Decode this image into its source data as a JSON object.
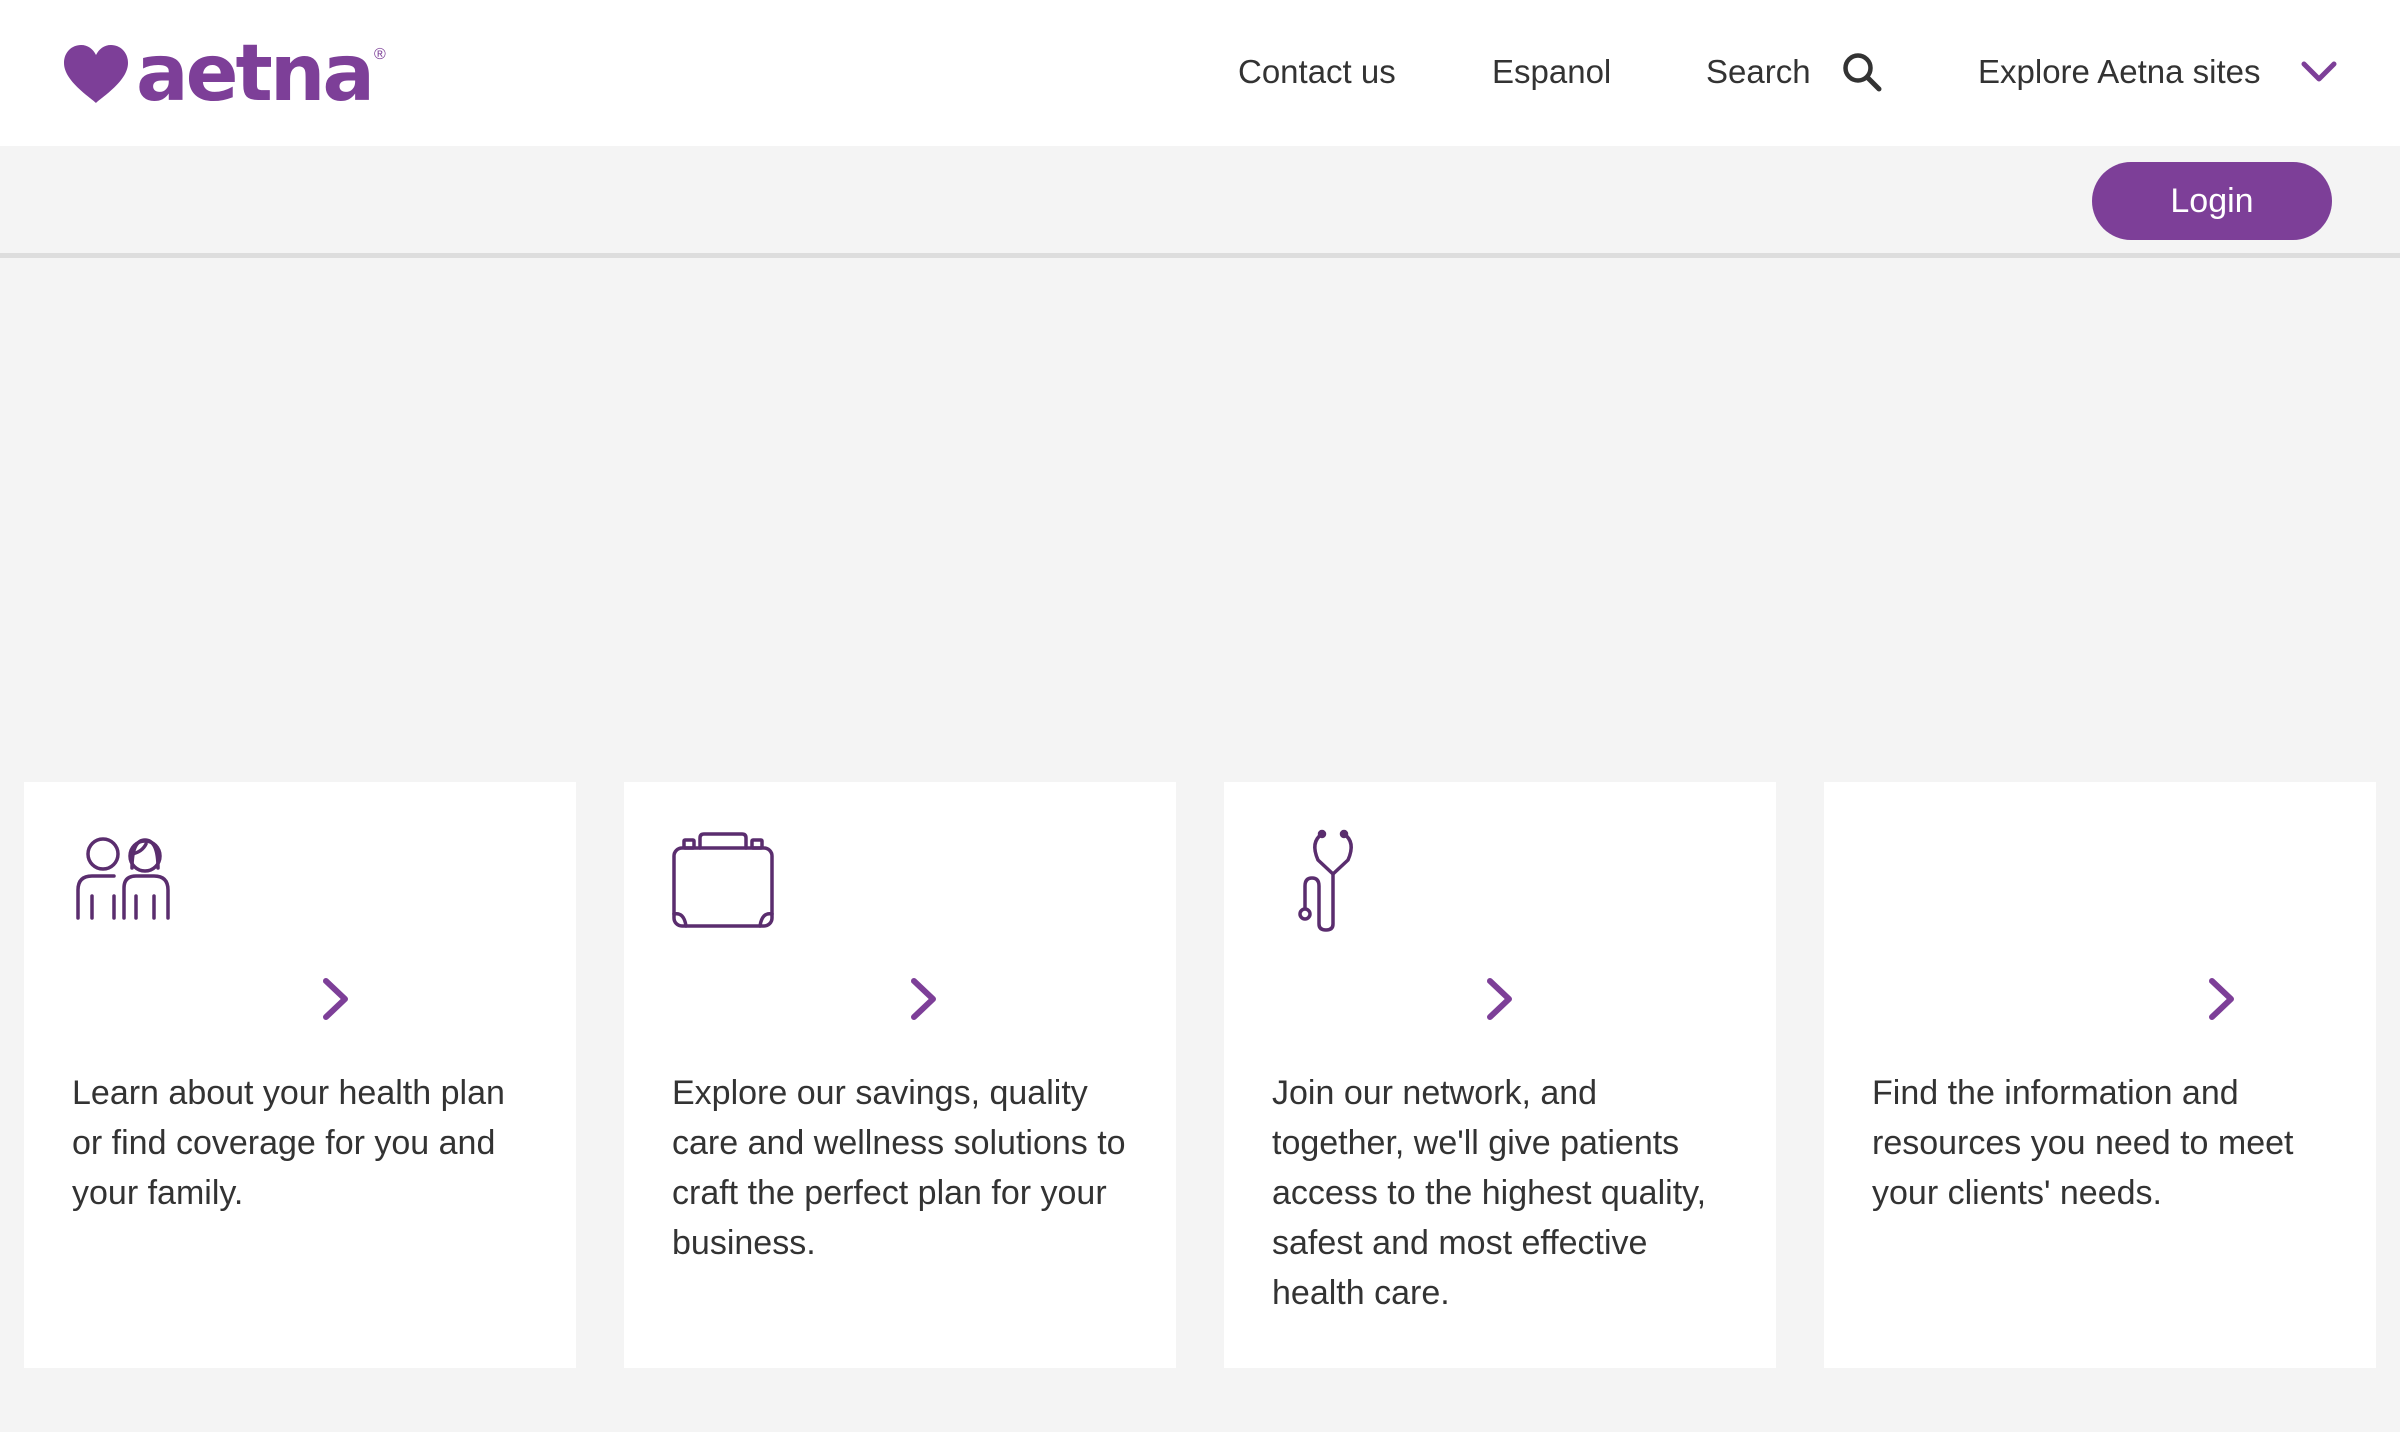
{
  "header": {
    "logo": {
      "text": "aetna",
      "registered_mark": "®",
      "icon": "heart-icon",
      "color": "#7d3f98"
    },
    "nav": {
      "contact": "Contact us",
      "espanol": "Espanol",
      "search": "Search",
      "explore": "Explore Aetna sites"
    }
  },
  "login_bar": {
    "login_label": "Login",
    "button_color": "#7d3f98"
  },
  "cards": [
    {
      "icon": "people-icon",
      "description": "Learn about your health plan or find coverage for you and your family."
    },
    {
      "icon": "briefcase-icon",
      "description": "Explore our savings, quality care and wellness solutions to craft the perfect plan for your business."
    },
    {
      "icon": "stethoscope-icon",
      "description": "Join our network, and together, we'll give patients access to the highest quality, safest and most effective health care."
    },
    {
      "icon": "",
      "description": "Find the information and resources you need to meet your clients' needs."
    }
  ],
  "colors": {
    "brand_purple": "#7d3f98",
    "icon_purple": "#5a2d6e",
    "page_background": "#f4f4f4",
    "card_background": "#ffffff",
    "text": "#333333"
  }
}
